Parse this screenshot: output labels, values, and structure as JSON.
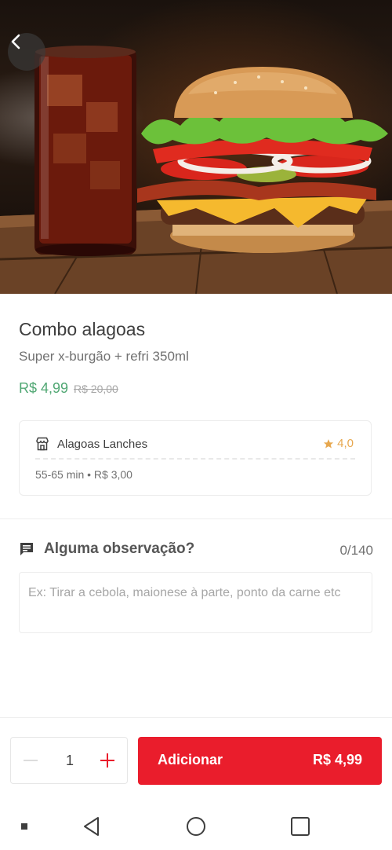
{
  "header": {
    "back_icon": "chevron-left-icon"
  },
  "product": {
    "title": "Combo alagoas",
    "description": "Super x-burgão + refri 350ml",
    "price": "R$ 4,99",
    "old_price": "R$ 20,00"
  },
  "store": {
    "icon": "store-icon",
    "name": "Alagoas Lanches",
    "rating": "4,0",
    "delivery_info": "55-65 min • R$ 3,00"
  },
  "observation": {
    "icon": "comment-icon",
    "title": "Alguma observação?",
    "counter": "0/140",
    "placeholder": "Ex: Tirar a cebola, maionese à parte, ponto da carne etc",
    "value": ""
  },
  "cart": {
    "quantity": "1",
    "add_label": "Adicionar",
    "add_price": "R$ 4,99"
  },
  "colors": {
    "primary_red": "#ea1d2c",
    "price_green": "#50a773",
    "rating_gold": "#e7a74e"
  },
  "system_nav": {
    "items": [
      "dot-icon",
      "back-triangle-icon",
      "home-circle-icon",
      "recents-square-icon"
    ]
  }
}
